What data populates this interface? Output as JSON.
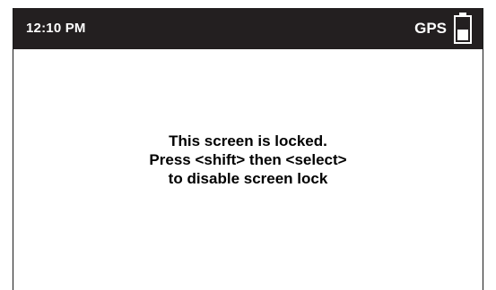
{
  "status_bar": {
    "time": "12:10 PM",
    "gps_label": "GPS",
    "battery_icon": "battery-icon",
    "background_color": "#231f20"
  },
  "lock_screen": {
    "lines": [
      "This screen is locked.",
      "Press <shift> then <select>",
      "to disable screen lock"
    ]
  }
}
